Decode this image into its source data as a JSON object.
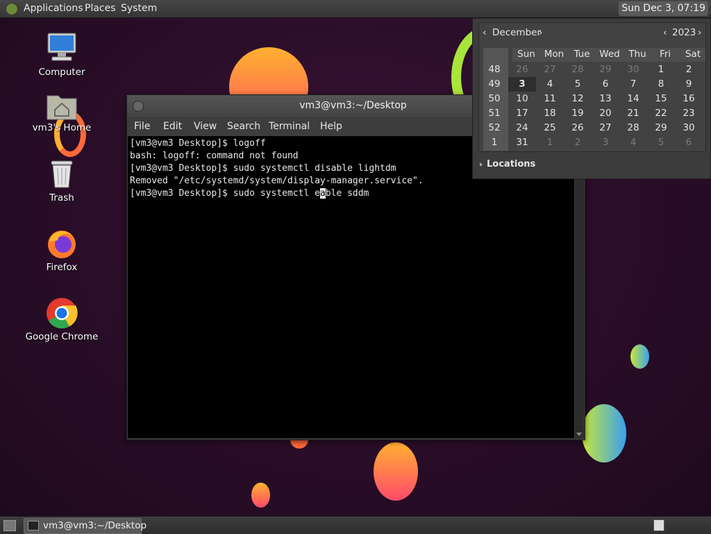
{
  "top_panel": {
    "menus": [
      "Applications",
      "Places",
      "System"
    ],
    "clock": "Sun Dec  3, 07:19"
  },
  "desktop_icons": [
    {
      "label": "Computer",
      "icon": "computer-icon"
    },
    {
      "label": "vm3's Home",
      "icon": "home-folder-icon"
    },
    {
      "label": "Trash",
      "icon": "trash-icon"
    },
    {
      "label": "Firefox",
      "icon": "firefox-icon"
    },
    {
      "label": "Google Chrome",
      "icon": "chrome-icon"
    }
  ],
  "terminal": {
    "title": "vm3@vm3:~/Desktop",
    "menu": [
      "File",
      "Edit",
      "View",
      "Search",
      "Terminal",
      "Help"
    ],
    "lines": [
      "[vm3@vm3 Desktop]$ logoff",
      "bash: logoff: command not found",
      "[vm3@vm3 Desktop]$ sudo systemctl disable lightdm",
      "Removed \"/etc/systemd/system/display-manager.service\"."
    ],
    "current_prefix": "[vm3@vm3 Desktop]$ sudo systemctl e",
    "cursor_char": "a",
    "current_suffix": "ble sddm"
  },
  "calendar": {
    "month": "December",
    "year": "2023",
    "weekdays": [
      "Sun",
      "Mon",
      "Tue",
      "Wed",
      "Thu",
      "Fri",
      "Sat"
    ],
    "weeks": [
      {
        "num": "48",
        "days": [
          "26",
          "27",
          "28",
          "29",
          "30",
          "1",
          "2"
        ],
        "dim": [
          true,
          true,
          true,
          true,
          true,
          false,
          false
        ]
      },
      {
        "num": "49",
        "days": [
          "3",
          "4",
          "5",
          "6",
          "7",
          "8",
          "9"
        ],
        "dim": [
          false,
          false,
          false,
          false,
          false,
          false,
          false
        ]
      },
      {
        "num": "50",
        "days": [
          "10",
          "11",
          "12",
          "13",
          "14",
          "15",
          "16"
        ],
        "dim": [
          false,
          false,
          false,
          false,
          false,
          false,
          false
        ]
      },
      {
        "num": "51",
        "days": [
          "17",
          "18",
          "19",
          "20",
          "21",
          "22",
          "23"
        ],
        "dim": [
          false,
          false,
          false,
          false,
          false,
          false,
          false
        ]
      },
      {
        "num": "52",
        "days": [
          "24",
          "25",
          "26",
          "27",
          "28",
          "29",
          "30"
        ],
        "dim": [
          false,
          false,
          false,
          false,
          false,
          false,
          false
        ]
      },
      {
        "num": "1",
        "days": [
          "31",
          "1",
          "2",
          "3",
          "4",
          "5",
          "6"
        ],
        "dim": [
          false,
          true,
          true,
          true,
          true,
          true,
          true
        ]
      }
    ],
    "today": "3",
    "locations_label": "Locations"
  },
  "bottom_panel": {
    "task_label": "vm3@vm3:~/Desktop"
  },
  "colors": {
    "panel": "#3a3a3a",
    "terminal_bg": "#000000",
    "desktop_bg": "#2a0f2a"
  }
}
